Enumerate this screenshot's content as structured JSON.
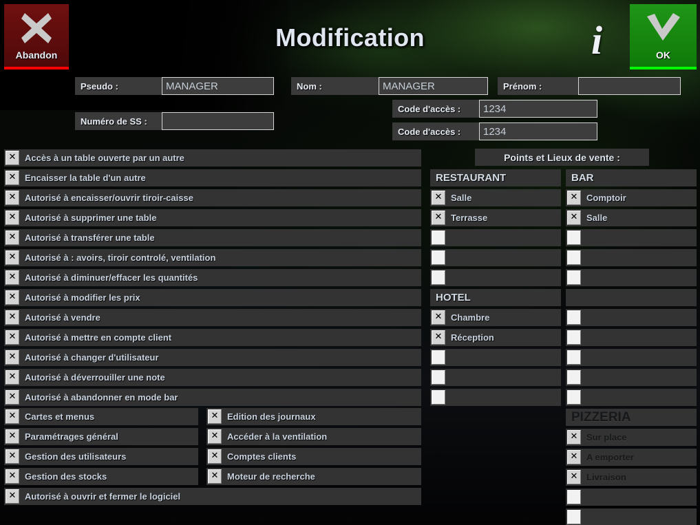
{
  "window": {
    "title": "Modification"
  },
  "header": {
    "abandon_label": "Abandon",
    "abandon_icon": "close-x-icon",
    "ok_label": "OK",
    "ok_icon": "checkmark-icon",
    "info_icon": "info-icon",
    "info_glyph": "i",
    "abandon_color": "#5e0c0c",
    "abandon_accent": "#ff0000",
    "ok_color": "#17870f",
    "ok_accent": "#00ff00"
  },
  "form": {
    "pseudo": {
      "label": "Pseudo :",
      "value": "MANAGER"
    },
    "nom": {
      "label": "Nom  :",
      "value": "MANAGER"
    },
    "prenom": {
      "label": "Prénom :",
      "value": ""
    },
    "numero_ss": {
      "label": "Numéro de SS :",
      "value": ""
    },
    "code_acces_1": {
      "label": "Code d'accès :",
      "value": "1234"
    },
    "code_acces_2": {
      "label": "Code d'accès :",
      "value": "1234"
    }
  },
  "permissions": {
    "full_width": [
      {
        "label": "Accès à un table ouverte par un autre",
        "checked": true
      },
      {
        "label": "Encaisser la table d'un autre",
        "checked": true
      },
      {
        "label": "Autorisé à encaisser/ouvrir tiroir-caisse",
        "checked": true
      },
      {
        "label": "Autorisé à supprimer une table",
        "checked": true
      },
      {
        "label": "Autorisé à transférer une table",
        "checked": true
      },
      {
        "label": "Autorisé à : avoirs, tiroir controlé, ventilation",
        "checked": true
      },
      {
        "label": "Autorisé à diminuer/effacer les quantités",
        "checked": true
      },
      {
        "label": "Autorisé à modifier les prix",
        "checked": true
      },
      {
        "label": "Autorisé à vendre",
        "checked": true
      },
      {
        "label": "Autorisé à mettre en compte client",
        "checked": true
      },
      {
        "label": "Autorisé à changer d'utilisateur",
        "checked": true
      },
      {
        "label": "Autorisé à déverrouiller une note",
        "checked": true
      },
      {
        "label": "Autorisé à abandonner en mode bar",
        "checked": true
      }
    ],
    "two_col_left": [
      {
        "label": "Cartes et menus",
        "checked": true
      },
      {
        "label": "Paramétrages général",
        "checked": true
      },
      {
        "label": "Gestion des utilisateurs",
        "checked": true
      },
      {
        "label": "Gestion des stocks",
        "checked": true
      }
    ],
    "two_col_right": [
      {
        "label": "Edition des journaux",
        "checked": true
      },
      {
        "label": "Accéder à la ventilation",
        "checked": true
      },
      {
        "label": "Comptes clients",
        "checked": true
      },
      {
        "label": "Moteur de recherche",
        "checked": true
      }
    ],
    "footer": [
      {
        "label": "Autorisé à ouvrir et fermer le logiciel",
        "checked": true
      }
    ]
  },
  "sales_points": {
    "title": "Points et Lieux de vente :",
    "groups": [
      {
        "heading": "RESTAURANT",
        "column": "left",
        "dark": false,
        "items": [
          {
            "label": "Salle",
            "checked": true
          },
          {
            "label": "Terrasse",
            "checked": true
          },
          {
            "label": "",
            "checked": false
          },
          {
            "label": "",
            "checked": false
          },
          {
            "label": "",
            "checked": false
          }
        ]
      },
      {
        "heading": "BAR",
        "column": "right",
        "dark": false,
        "items": [
          {
            "label": "Comptoir",
            "checked": true
          },
          {
            "label": "Salle",
            "checked": true
          },
          {
            "label": "",
            "checked": false
          },
          {
            "label": "",
            "checked": false
          },
          {
            "label": "",
            "checked": false
          }
        ]
      },
      {
        "heading": "HOTEL",
        "column": "left",
        "dark": false,
        "items": [
          {
            "label": "Chambre",
            "checked": true
          },
          {
            "label": "Réception",
            "checked": true
          },
          {
            "label": "",
            "checked": false
          },
          {
            "label": "",
            "checked": false
          },
          {
            "label": "",
            "checked": false
          }
        ]
      },
      {
        "heading": "",
        "column": "right",
        "dark": false,
        "items": [
          {
            "label": "",
            "checked": false
          },
          {
            "label": "",
            "checked": false
          },
          {
            "label": "",
            "checked": false
          },
          {
            "label": "",
            "checked": false
          },
          {
            "label": "",
            "checked": false
          }
        ]
      },
      {
        "heading": "PIZZERIA",
        "column": "right",
        "dark": true,
        "items": [
          {
            "label": "Sur place",
            "checked": true
          },
          {
            "label": "A emporter",
            "checked": true
          },
          {
            "label": "Livraison",
            "checked": true
          },
          {
            "label": "",
            "checked": false
          },
          {
            "label": "",
            "checked": false
          }
        ]
      }
    ]
  },
  "checkbox_mark": "✕"
}
